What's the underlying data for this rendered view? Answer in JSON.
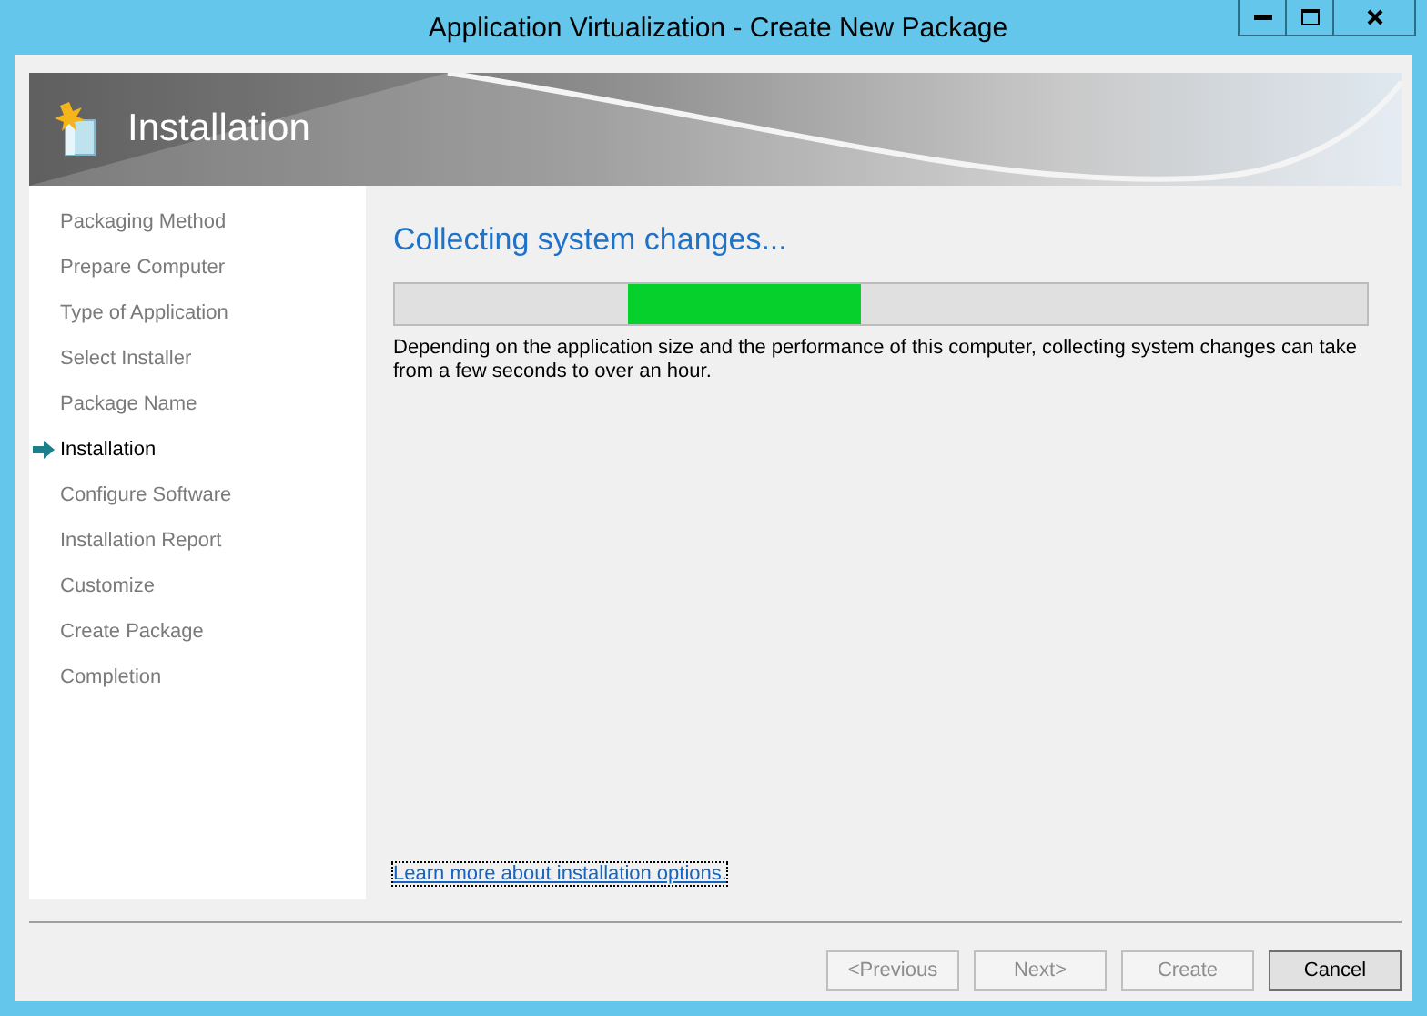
{
  "window": {
    "title": "Application Virtualization - Create New Package"
  },
  "header": {
    "title": "Installation"
  },
  "steps": [
    {
      "label": "Packaging Method",
      "selected": false
    },
    {
      "label": "Prepare Computer",
      "selected": false
    },
    {
      "label": "Type of Application",
      "selected": false
    },
    {
      "label": "Select Installer",
      "selected": false
    },
    {
      "label": "Package Name",
      "selected": false
    },
    {
      "label": "Installation",
      "selected": true
    },
    {
      "label": "Configure Software",
      "selected": false
    },
    {
      "label": "Installation Report",
      "selected": false
    },
    {
      "label": "Customize",
      "selected": false
    },
    {
      "label": "Create Package",
      "selected": false
    },
    {
      "label": "Completion",
      "selected": false
    }
  ],
  "content": {
    "heading": "Collecting system changes...",
    "progress": {
      "level": 0.48
    },
    "description": "Depending on the application size and the performance of this computer, collecting system changes can take from a few seconds to over an hour.",
    "link": "Learn more about installation options."
  },
  "buttons": [
    {
      "label": "<Previous",
      "disabled": true
    },
    {
      "label": "Next>",
      "disabled": true
    },
    {
      "label": "Create",
      "disabled": true
    },
    {
      "label": "Cancel",
      "disabled": false
    }
  ]
}
